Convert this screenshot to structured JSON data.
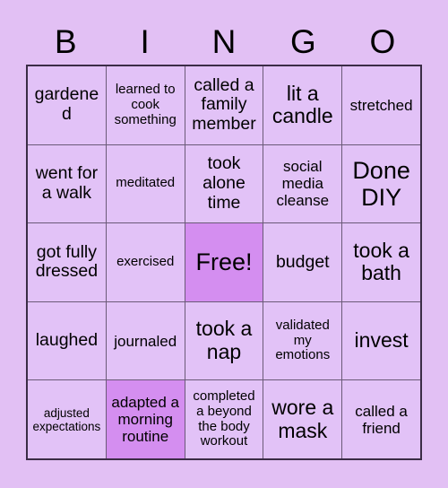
{
  "header": {
    "letters": [
      "B",
      "I",
      "N",
      "G",
      "O"
    ]
  },
  "grid": {
    "rows": [
      [
        {
          "text": "gardened",
          "size": "fs-l",
          "marked": false
        },
        {
          "text": "learned to cook something",
          "size": "fs-s",
          "marked": false
        },
        {
          "text": "called a family member",
          "size": "fs-l",
          "marked": false
        },
        {
          "text": "lit a candle",
          "size": "fs-xl",
          "marked": false
        },
        {
          "text": "stretched",
          "size": "fs-m",
          "marked": false
        }
      ],
      [
        {
          "text": "went for a walk",
          "size": "fs-l",
          "marked": false
        },
        {
          "text": "meditated",
          "size": "fs-s",
          "marked": false
        },
        {
          "text": "took alone time",
          "size": "fs-l",
          "marked": false
        },
        {
          "text": "social media cleanse",
          "size": "fs-m",
          "marked": false
        },
        {
          "text": "Done DIY",
          "size": "fs-xxl",
          "marked": false
        }
      ],
      [
        {
          "text": "got fully dressed",
          "size": "fs-l",
          "marked": false
        },
        {
          "text": "exercised",
          "size": "fs-s",
          "marked": false
        },
        {
          "text": "Free!",
          "size": "fs-xxl",
          "marked": true
        },
        {
          "text": "budget",
          "size": "fs-l",
          "marked": false
        },
        {
          "text": "took a bath",
          "size": "fs-xl",
          "marked": false
        }
      ],
      [
        {
          "text": "laughed",
          "size": "fs-l",
          "marked": false
        },
        {
          "text": "journaled",
          "size": "fs-m",
          "marked": false
        },
        {
          "text": "took a nap",
          "size": "fs-xl",
          "marked": false
        },
        {
          "text": "validated my emotions",
          "size": "fs-s",
          "marked": false
        },
        {
          "text": "invest",
          "size": "fs-xl",
          "marked": false
        }
      ],
      [
        {
          "text": "adjusted expectations",
          "size": "fs-xs",
          "marked": false
        },
        {
          "text": "adapted a morning routine",
          "size": "fs-m",
          "marked": true
        },
        {
          "text": "completed a beyond the body workout",
          "size": "fs-s",
          "marked": false
        },
        {
          "text": "wore a mask",
          "size": "fs-xl",
          "marked": false
        },
        {
          "text": "called a friend",
          "size": "fs-m",
          "marked": false
        }
      ]
    ]
  },
  "colors": {
    "page_background": "#e2c0f4",
    "cell_background": "#e2c2f7",
    "marked_background": "#d48ef0",
    "border": "#3b2c46",
    "text": "#000000"
  }
}
